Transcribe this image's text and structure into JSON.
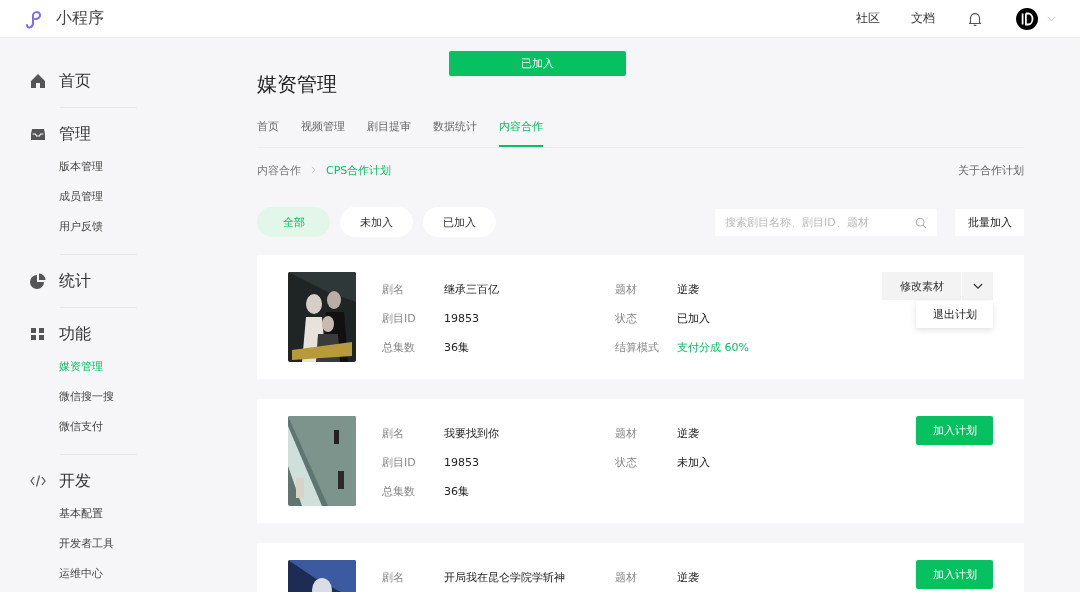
{
  "header": {
    "app_name": "小程序",
    "links": [
      "社区",
      "文档"
    ]
  },
  "toast": "已加入",
  "sidebar": [
    {
      "title": "首页"
    },
    {
      "title": "管理",
      "items": [
        {
          "label": "版本管理",
          "selected": false
        },
        {
          "label": "成员管理",
          "selected": false
        },
        {
          "label": "用户反馈",
          "selected": false
        }
      ]
    },
    {
      "title": "统计"
    },
    {
      "title": "功能",
      "items": [
        {
          "label": "媒资管理",
          "selected": true
        },
        {
          "label": "微信搜一搜",
          "selected": false
        },
        {
          "label": "微信支付",
          "selected": false
        }
      ]
    },
    {
      "title": "开发",
      "items": [
        {
          "label": "基本配置",
          "selected": false
        },
        {
          "label": "开发者工具",
          "selected": false
        },
        {
          "label": "运维中心",
          "selected": false
        }
      ]
    }
  ],
  "page_title": "媒资管理",
  "tabs": [
    {
      "label": "首页",
      "selected": false
    },
    {
      "label": "视频管理",
      "selected": false
    },
    {
      "label": "剧目提审",
      "selected": false
    },
    {
      "label": "数据统计",
      "selected": false
    },
    {
      "label": "内容合作",
      "selected": true
    }
  ],
  "breadcrumb": [
    "内容合作",
    "CPS合作计划"
  ],
  "about_link": "关于合作计划",
  "filters": [
    {
      "label": "全部",
      "selected": true
    },
    {
      "label": "未加入",
      "selected": false
    },
    {
      "label": "已加入",
      "selected": false
    }
  ],
  "search": {
    "placeholder": "搜索剧目名称、剧目ID、题材"
  },
  "batch_button": "批量加入",
  "cards": [
    {
      "left_fields": [
        {
          "label": "剧名",
          "value": "继承三百亿"
        },
        {
          "label": "剧目ID",
          "value": "19853"
        },
        {
          "label": "总集数",
          "value": "36集"
        }
      ],
      "right_fields": [
        {
          "label": "题材",
          "value": "逆袭"
        },
        {
          "label": "状态",
          "value": "已加入"
        },
        {
          "label": "结算模式",
          "value": "支付分成 60%",
          "accent": true
        }
      ],
      "action": {
        "kind": "split",
        "label": "修改素材",
        "menu_open": true,
        "menu": [
          "退出计划"
        ]
      }
    },
    {
      "left_fields": [
        {
          "label": "剧名",
          "value": "我要找到你"
        },
        {
          "label": "剧目ID",
          "value": "19853"
        },
        {
          "label": "总集数",
          "value": "36集"
        }
      ],
      "right_fields": [
        {
          "label": "题材",
          "value": "逆袭"
        },
        {
          "label": "状态",
          "value": "未加入"
        }
      ],
      "action": {
        "kind": "button",
        "label": "加入计划"
      }
    },
    {
      "left_fields": [
        {
          "label": "剧名",
          "value": "开局我在昆仑学院学斩神"
        }
      ],
      "right_fields": [
        {
          "label": "题材",
          "value": "逆袭"
        }
      ],
      "action": {
        "kind": "button",
        "label": "加入计划"
      }
    }
  ]
}
